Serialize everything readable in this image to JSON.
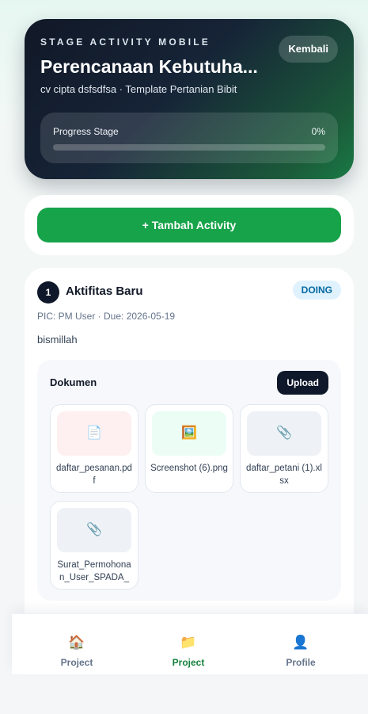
{
  "hero": {
    "eyebrow": "STAGE ACTIVITY MOBILE",
    "title": "Perencanaan Kebutuha...",
    "subtitle": "cv cipta dsfsdfsa · Template Pertanian Bibit",
    "back_label": "Kembali",
    "progress_label": "Progress Stage",
    "progress_text": "0%",
    "progress_value": 0
  },
  "actions": {
    "add_label": "+ Tambah Activity"
  },
  "activity": {
    "number": "1",
    "title": "Aktifitas Baru",
    "status": "DOING",
    "meta": "PIC: PM User · Due: 2026-05-19",
    "description": "bismillah",
    "documents": {
      "title": "Dokumen",
      "upload_label": "Upload",
      "files": [
        {
          "name": "daftar_pesanan.pdf",
          "icon": "page-facing-up-icon",
          "glyph": "📄"
        },
        {
          "name": "Screenshot (6).png",
          "icon": "framed-picture-icon",
          "glyph": "🖼️"
        },
        {
          "name": "daftar_petani (1).xlsx",
          "icon": "paperclip-icon",
          "glyph": "📎"
        },
        {
          "name": "Surat_Permohonan_User_SPADA_I...",
          "icon": "paperclip-icon",
          "glyph": "📎"
        }
      ]
    }
  },
  "nav": {
    "items": [
      {
        "label": "Project",
        "icon": "house-icon",
        "glyph": "🏠",
        "active": false
      },
      {
        "label": "Project",
        "icon": "folder-icon",
        "glyph": "📁",
        "active": true
      },
      {
        "label": "Profile",
        "icon": "user-icon",
        "glyph": "👤",
        "active": false
      }
    ]
  },
  "colors": {
    "primary_green": "#16a34a",
    "dark": "#0f172a",
    "status_doing_bg": "#e0f2fe",
    "status_doing_text": "#0369a1"
  }
}
